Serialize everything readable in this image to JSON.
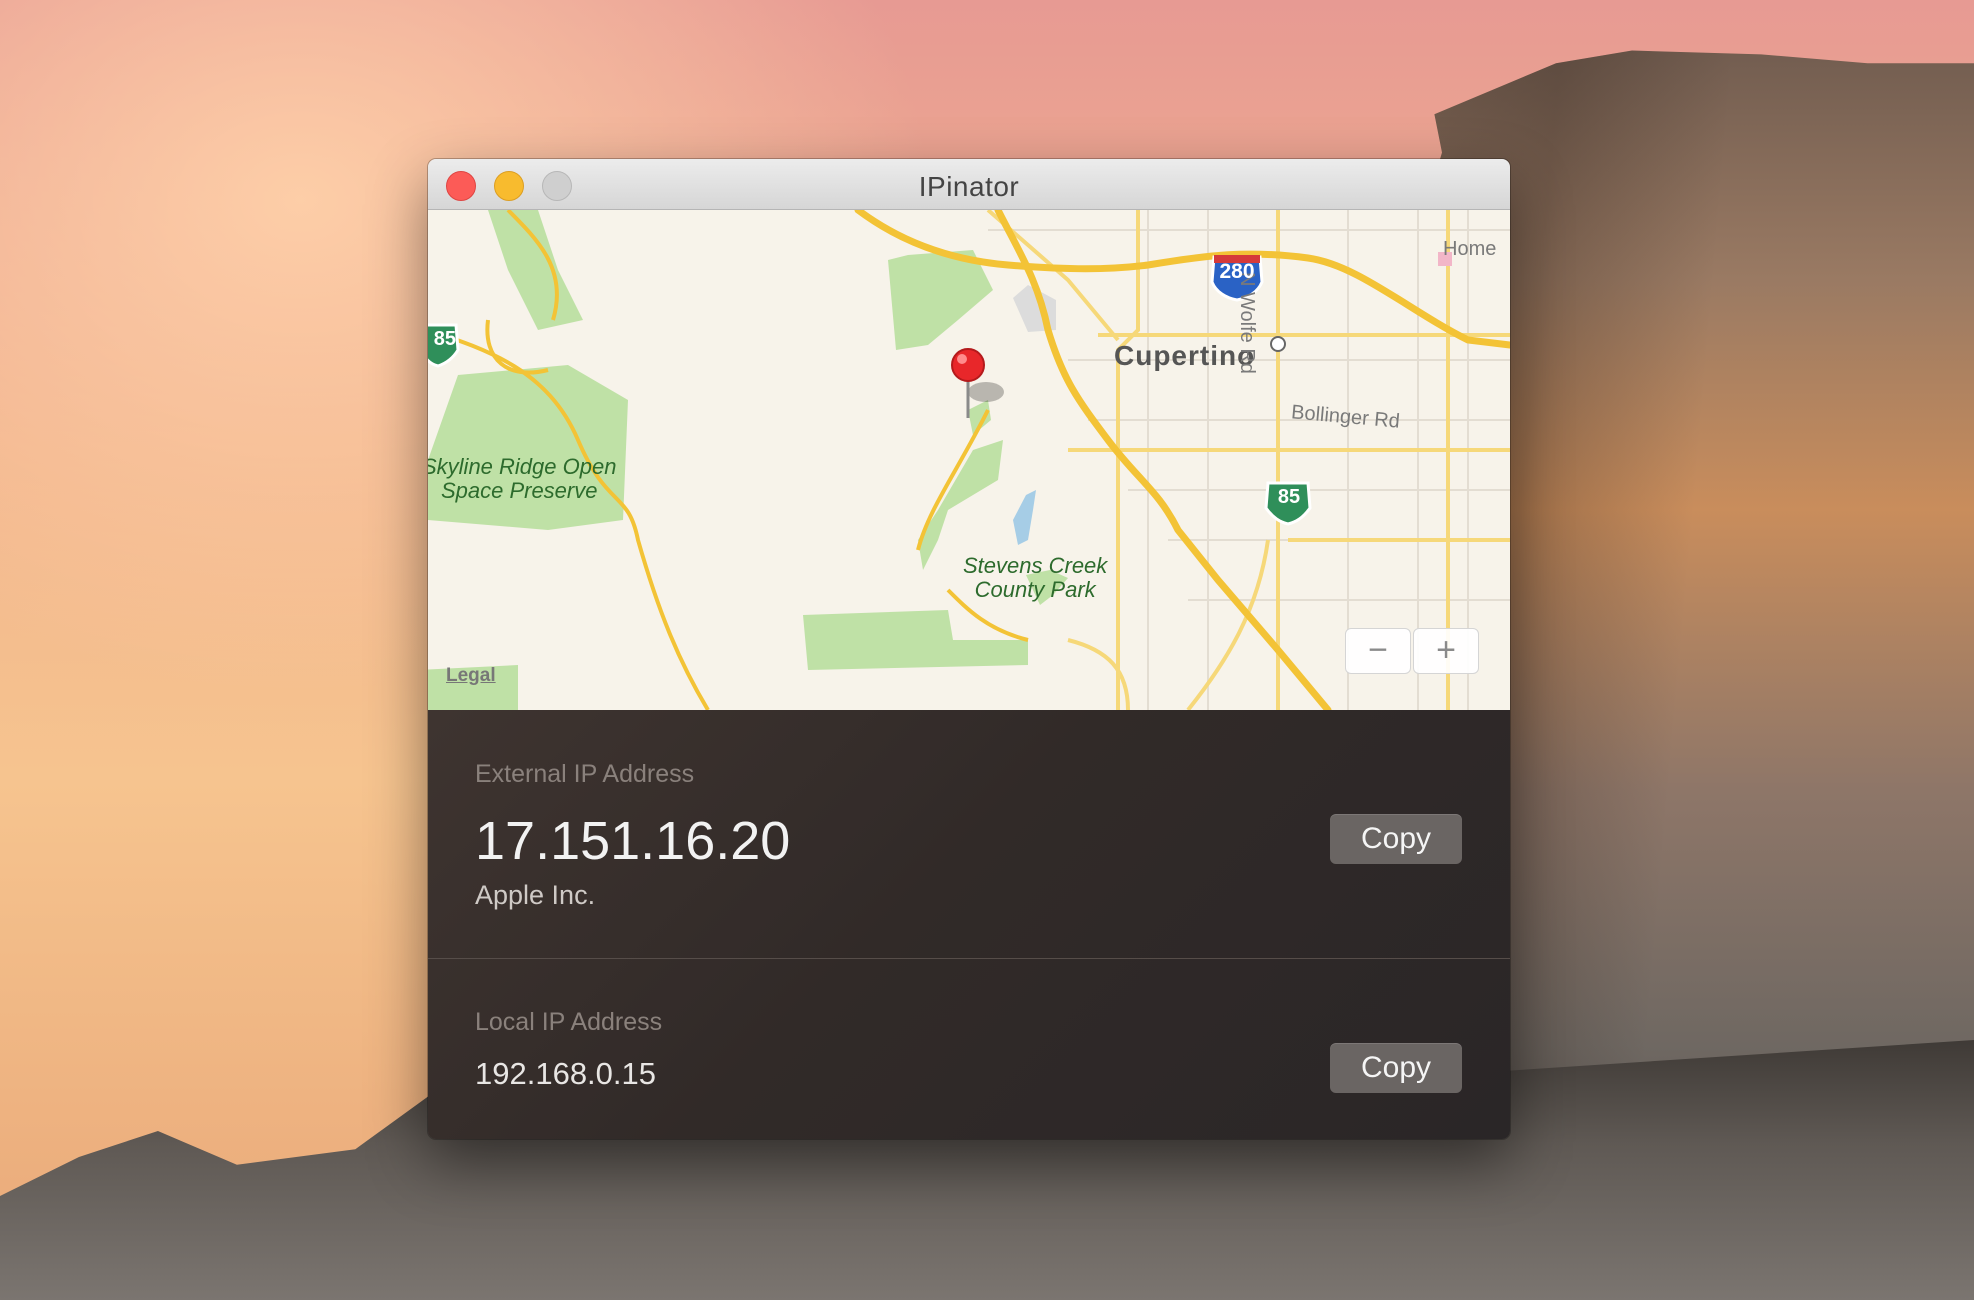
{
  "window": {
    "title": "IPinator"
  },
  "map": {
    "parks": {
      "skyline_line1": "Skyline Ridge Open",
      "skyline_line2": "Space Preserve",
      "stevens_line1": "Stevens Creek",
      "stevens_line2": "County Park"
    },
    "city": "Cupertino",
    "streets": {
      "bollinger": "Bollinger Rd",
      "wolfe": "N Wolfe Rd",
      "home": "Home"
    },
    "shields": {
      "i280": "280",
      "ca85_right": "85",
      "ca85_left": "85"
    },
    "legal": "Legal",
    "zoom_out": "−",
    "zoom_in": "+"
  },
  "external": {
    "label": "External IP Address",
    "ip": "17.151.16.20",
    "org": "Apple Inc.",
    "copy_label": "Copy"
  },
  "local": {
    "label": "Local IP Address",
    "ip": "192.168.0.15",
    "copy_label": "Copy"
  },
  "colors": {
    "close": "#fc5b57",
    "minimize": "#f8bb2e",
    "zoom": "#cfcfcf",
    "highway": "#f3c336",
    "park": "#bfe1a6",
    "panel": "#312a28"
  }
}
